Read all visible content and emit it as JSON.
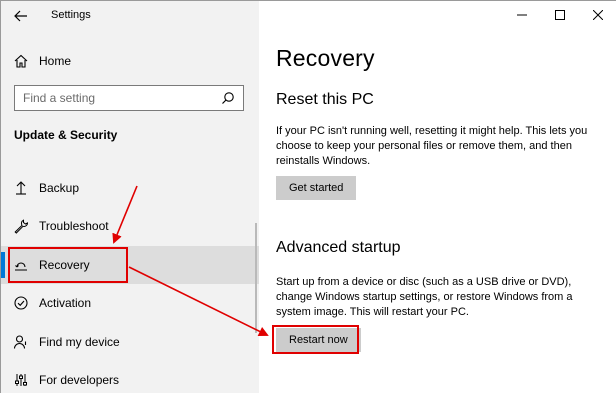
{
  "window": {
    "app_title": "Settings"
  },
  "sidebar": {
    "home_label": "Home",
    "search_placeholder": "Find a setting",
    "section_title": "Update & Security",
    "items": [
      {
        "label": "Backup",
        "icon": "backup-arrow-icon"
      },
      {
        "label": "Troubleshoot",
        "icon": "wrench-icon"
      },
      {
        "label": "Recovery",
        "icon": "recovery-icon",
        "selected": true
      },
      {
        "label": "Activation",
        "icon": "activation-check-icon"
      },
      {
        "label": "Find my device",
        "icon": "person-location-icon"
      },
      {
        "label": "For developers",
        "icon": "developer-sliders-icon"
      }
    ]
  },
  "main": {
    "title": "Recovery",
    "reset": {
      "heading": "Reset this PC",
      "text": "If your PC isn't running well, resetting it might help. This lets you choose to keep your personal files or remove them, and then reinstalls Windows.",
      "button_label": "Get started"
    },
    "advanced": {
      "heading": "Advanced startup",
      "text": "Start up from a device or disc (such as a USB drive or DVD), change Windows startup settings, or restore Windows from a system image. This will restart your PC.",
      "button_label": "Restart now"
    }
  },
  "colors": {
    "accent": "#0078d7",
    "annotation": "#e00000",
    "sidebar_bg": "#f2f2f2",
    "selected_bg": "#dddddd",
    "button_bg": "#cccccc"
  }
}
